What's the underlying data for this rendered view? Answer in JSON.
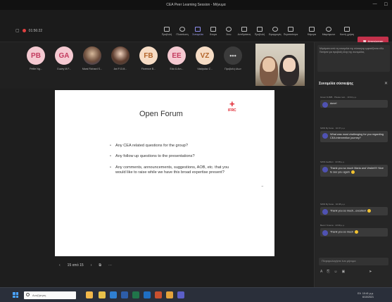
{
  "window": {
    "title": "CEA Peer Learning Session - Μήνυμα"
  },
  "toolbar": {
    "meeting_timer": "01:56:22",
    "tools": [
      {
        "label": "Προβολή",
        "icon": "view-icon"
      },
      {
        "label": "Πλαισίωση",
        "icon": "whiteboard-icon"
      },
      {
        "label": "Συνομιλία",
        "icon": "chat-icon"
      },
      {
        "label": "Άτομα",
        "icon": "people-icon"
      },
      {
        "label": "Άνω",
        "icon": "raise-hand-icon"
      },
      {
        "label": "Αντιδράσεις",
        "icon": "reactions-icon"
      },
      {
        "label": "Προβολή",
        "icon": "layout-icon"
      },
      {
        "label": "Εφαρμογές",
        "icon": "apps-icon"
      },
      {
        "label": "Περισσότερα",
        "icon": "more-icon"
      },
      {
        "label": "Κάμερα",
        "icon": "camera-icon"
      },
      {
        "label": "Μικρόφωνο",
        "icon": "mic-icon"
      },
      {
        "label": "Κοινή χρήση",
        "icon": "share-icon"
      }
    ],
    "leave_label": "Αποχώρηση"
  },
  "participants": [
    {
      "initials": "PB",
      "name": "Petite Ng...",
      "color": "#f4c9d1",
      "text_color": "#c33b5f"
    },
    {
      "initials": "GA",
      "name": "Guzey M.F...",
      "color": "#f4c9d1",
      "text_color": "#c33b5f"
    },
    {
      "initials": "",
      "name": "Mwai Richard S...",
      "photo": "1"
    },
    {
      "initials": "",
      "name": "Ani F.G.M...",
      "photo": "2"
    },
    {
      "initials": "FB",
      "name": "Florence B...",
      "color": "#f6dcc5",
      "text_color": "#b3652b"
    },
    {
      "initials": "EE",
      "name": "Edu & Am...",
      "color": "#f4c9d1",
      "text_color": "#c33b5f"
    },
    {
      "initials": "VZ",
      "name": "Vladyslav Z...",
      "color": "#f6dcc5",
      "text_color": "#b3652b"
    },
    {
      "initials": "•••",
      "name": "Προβολή όλων",
      "dots": "1"
    }
  ],
  "slide": {
    "title": "Open Forum",
    "brand": "IFRC",
    "bullets": [
      "Any CEA related questions for the group?",
      "Any follow up questions to the presentations?",
      "Any comments, announcements, suggestions, AOB, etc. that you would like to raise while we have this broad expertise present?"
    ],
    "nav_label": "15 από 15"
  },
  "chat": {
    "banner": "Μηνύματα από τη συνομιλία της σύσκεψης εμφανίζονται εδώ. Πατήστε για προβολή όλης της συνομιλίας.",
    "header": "Συνομιλία σύσκεψης",
    "messages": [
      {
        "meta": "Green NJMB · Please rest... 10:34 μ.μ.",
        "text": "done!"
      },
      {
        "meta": "SWD By Kane · 10:37 μ.μ.",
        "text": "What was most challenging for you regarding CEA intervention journey?"
      },
      {
        "meta": "SWD Asaffeni · 10:38 μ.μ.",
        "text": "Thank you so much Maria and Vesilei!!!! Nice to see you again"
      },
      {
        "meta": "SWD By Kane · 10:38 μ.μ.",
        "text": "Thank you so much...excellent"
      },
      {
        "meta": "Beoni Yonena · 10:39 μ.μ.",
        "text": "Thank you so much"
      }
    ],
    "input_placeholder": "Πληκτρολογήστε ένα μήνυμα"
  },
  "taskbar": {
    "search_placeholder": "Αναζήτηση",
    "time": "10:41 μ.μ.",
    "date": "6/10/2021",
    "lang": "ΕΛ"
  }
}
